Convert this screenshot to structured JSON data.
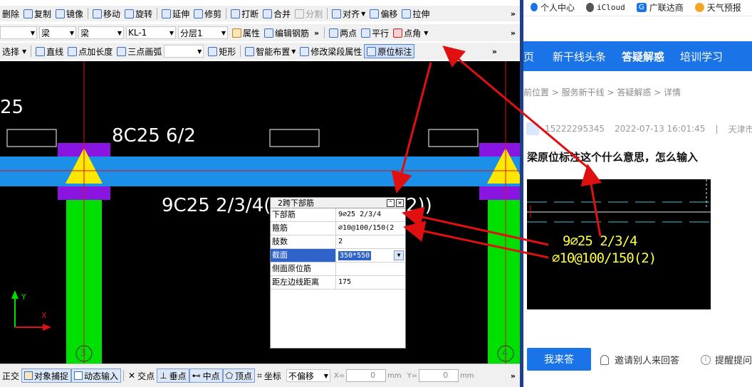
{
  "toolbar1": {
    "items": [
      "删除",
      "复制",
      "镜像",
      "移动",
      "旋转",
      "延伸",
      "修剪",
      "打断",
      "合并",
      "分割",
      "对齐",
      "偏移",
      "拉伸"
    ]
  },
  "toolbar2": {
    "dropdowns": [
      "梁",
      "梁",
      "KL-1",
      "分层1"
    ],
    "items": [
      "属性",
      "编辑钢筋",
      "两点",
      "平行",
      "点角"
    ]
  },
  "toolbar3": {
    "first": "选择",
    "items": [
      "直线",
      "点加长度",
      "三点画弧",
      "矩形",
      "智能布置",
      "修改梁段属性",
      "原位标注"
    ]
  },
  "canvas": {
    "top_left_text": "25",
    "top_label": "8C25 6/2",
    "bottom_label": "9C25 2/3/4(",
    "bottom_label_tail": "2))",
    "axis_left": "3",
    "axis_right": "4",
    "y_axis": "Y",
    "x_axis": "X"
  },
  "panel": {
    "title": "2跨下部筋",
    "rows": [
      {
        "key": "下部筋",
        "value": "9⌀25 2/3/4"
      },
      {
        "key": "箍筋",
        "value": "⌀10@100/150(2"
      },
      {
        "key": "肢数",
        "value": "2"
      },
      {
        "key": "截面",
        "value": "350*550"
      },
      {
        "key": "侧面原位筋",
        "value": ""
      },
      {
        "key": "距左边线距离",
        "value": "175"
      }
    ]
  },
  "statusbar": {
    "items": [
      "正交",
      "对象捕捉",
      "动态输入",
      "交点",
      "垂点",
      "中点",
      "顶点",
      "坐标"
    ],
    "offset_select": "不偏移",
    "x_label": "X=",
    "x_value": "0",
    "y_label": "Y=",
    "y_value": "0",
    "unit": "mm"
  },
  "browser": {
    "bookmarks": [
      "个人中心",
      "iCloud",
      "广联达商",
      "天气预报"
    ],
    "nav": [
      "页",
      "新干线头条",
      "答疑解惑",
      "培训学习"
    ],
    "breadcrumb": "前位置 > 服务新干线 > 答疑解惑 > 详情",
    "user": "15222295345",
    "datetime": "2022-07-13 16:01:45",
    "meta_sep": "|",
    "location": "天津市",
    "question_title": "梁原位标注这个什么意思，怎么输入",
    "img_line1": "9⌀25 2/3/4",
    "img_line2": "⌀10@100/150(2)",
    "answer_btn": "我来答",
    "invite": "邀请别人来回答",
    "remind": "提醒提问"
  },
  "colors": {
    "nav_blue": "#1a74e8",
    "beam_blue": "#1c8fe8",
    "column_green": "#00e000",
    "support_purple": "#8a14e0",
    "support_yellow": "#ffe800",
    "annotation_red": "#e01010"
  }
}
